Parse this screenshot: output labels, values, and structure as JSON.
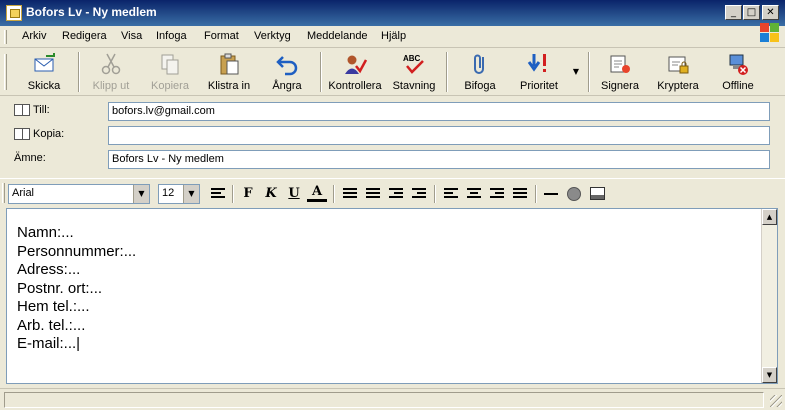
{
  "window": {
    "title": "Bofors Lv - Ny medlem"
  },
  "menu": [
    "Arkiv",
    "Redigera",
    "Visa",
    "Infoga",
    "Format",
    "Verktyg",
    "Meddelande",
    "Hjälp"
  ],
  "toolbar": {
    "send": "Skicka",
    "cut": "Klipp ut",
    "copy": "Kopiera",
    "paste": "Klistra in",
    "undo": "Ångra",
    "check": "Kontrollera",
    "spelling": "Stavning",
    "spelling_badge": "ABC",
    "attach": "Bifoga",
    "priority": "Prioritet",
    "sign": "Signera",
    "encrypt": "Kryptera",
    "offline": "Offline"
  },
  "headers": {
    "to_label": "Till:",
    "to_value": "bofors.lv@gmail.com",
    "cc_label": "Kopia:",
    "cc_value": "",
    "subject_label": "Ämne:",
    "subject_value": "Bofors Lv - Ny medlem"
  },
  "format": {
    "font": "Arial",
    "size": "12",
    "bold": "F",
    "italic": "K",
    "underline": "U",
    "fontcolor": "A"
  },
  "body_lines": [
    "Namn:...",
    "Personnummer:...",
    "Adress:...",
    "Postnr. ort:...",
    "Hem tel.:...",
    "Arb. tel.:...",
    "E-mail:...|"
  ],
  "colors": {
    "titlebar": "#0a246a",
    "chrome": "#ece9d8",
    "field_border": "#7f9db9",
    "disabled_text": "#a19f96"
  }
}
